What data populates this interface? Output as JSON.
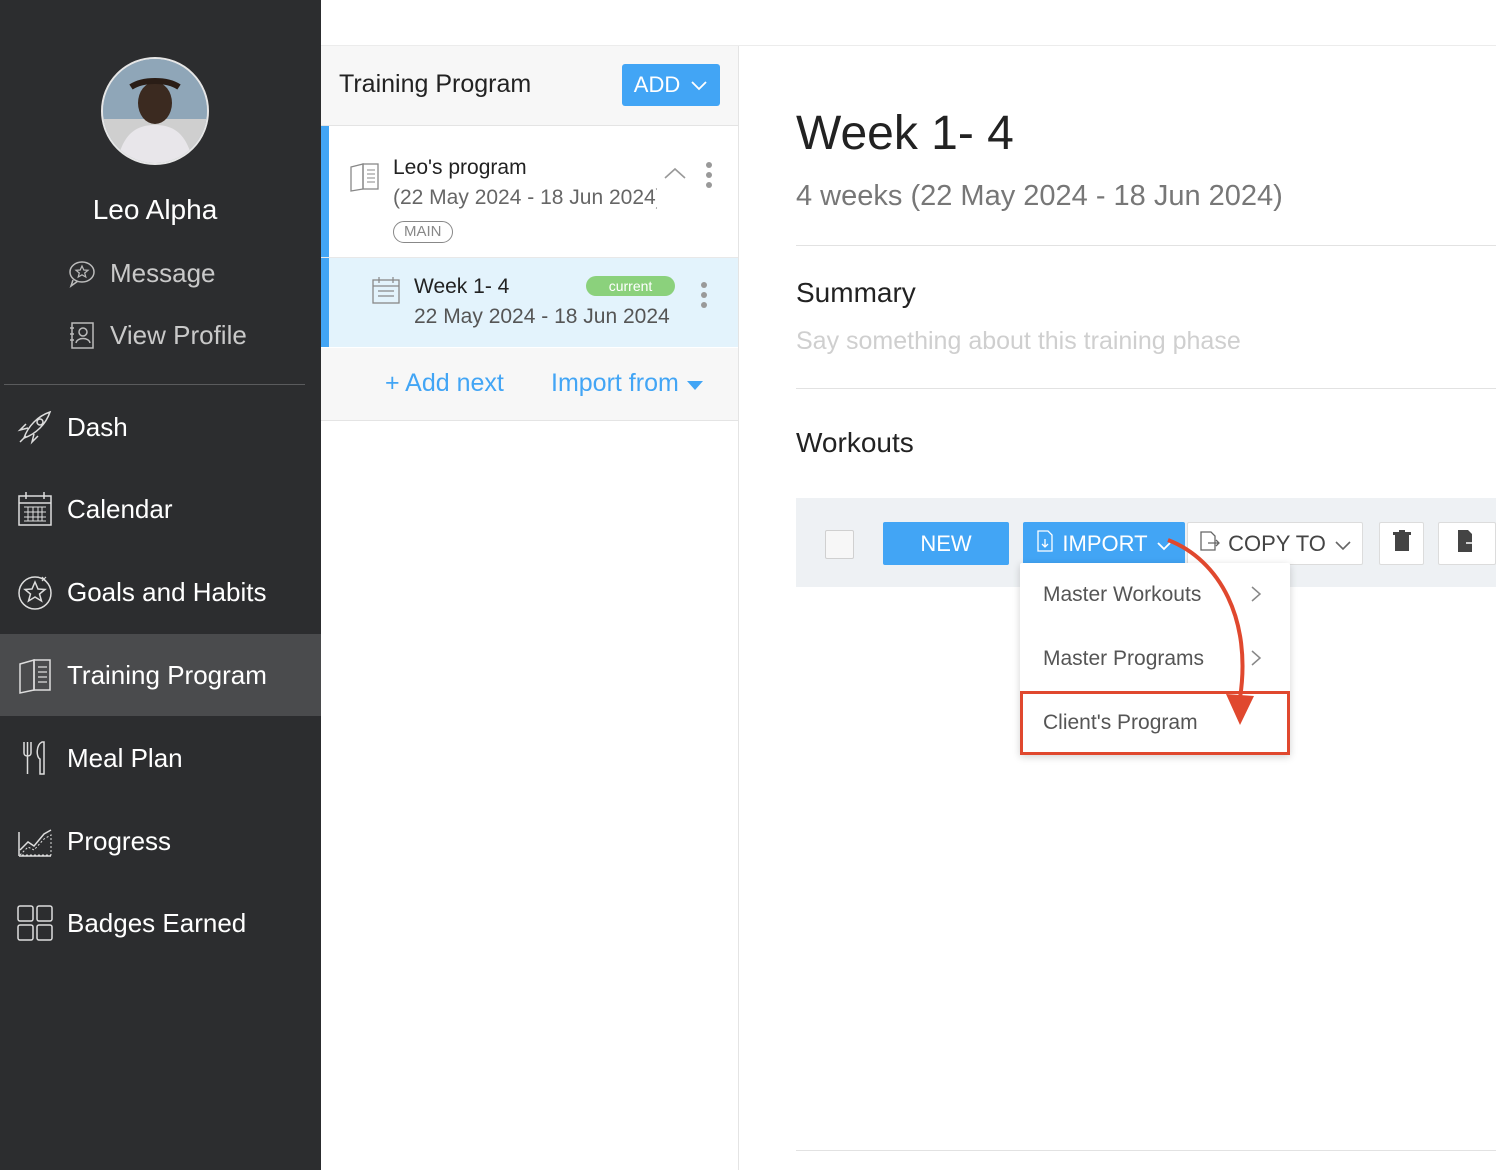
{
  "sidebar": {
    "user_name": "Leo Alpha",
    "links": {
      "message": "Message",
      "view_profile": "View Profile"
    },
    "nav": [
      {
        "label": "Dash",
        "icon": "rocket-icon"
      },
      {
        "label": "Calendar",
        "icon": "calendar-icon"
      },
      {
        "label": "Goals and Habits",
        "icon": "star-badge-icon"
      },
      {
        "label": "Training Program",
        "icon": "book-icon",
        "active": true
      },
      {
        "label": "Meal Plan",
        "icon": "utensils-icon"
      },
      {
        "label": "Progress",
        "icon": "chart-icon"
      },
      {
        "label": "Badges Earned",
        "icon": "grid-icon"
      }
    ]
  },
  "middle": {
    "title": "Training Program",
    "add_label": "ADD",
    "program": {
      "name": "Leo's program",
      "dates": "(22 May 2024 - 18 Jun 2024)",
      "badge": "MAIN"
    },
    "phase": {
      "name": "Week 1- 4",
      "dates": "22 May 2024 - 18 Jun 2024",
      "badge": "current"
    },
    "add_next": "+ Add next",
    "import_from": "Import from"
  },
  "main": {
    "title": "Week 1- 4",
    "subtitle": "4 weeks (22 May 2024 - 18 Jun 2024)",
    "summary_title": "Summary",
    "summary_placeholder": "Say something about this training phase",
    "workouts_title": "Workouts",
    "toolbar": {
      "new_label": "NEW",
      "import_label": "IMPORT",
      "copy_to_label": "COPY TO"
    },
    "import_menu": [
      {
        "label": "Master Workouts",
        "has_submenu": true
      },
      {
        "label": "Master Programs",
        "has_submenu": true
      },
      {
        "label": "Client's Program",
        "has_submenu": false,
        "highlighted": true
      }
    ]
  },
  "colors": {
    "sidebar_bg": "#2c2d2f",
    "accent": "#42a5f5",
    "current_badge": "#8bd17c",
    "highlight": "#e0482e"
  }
}
